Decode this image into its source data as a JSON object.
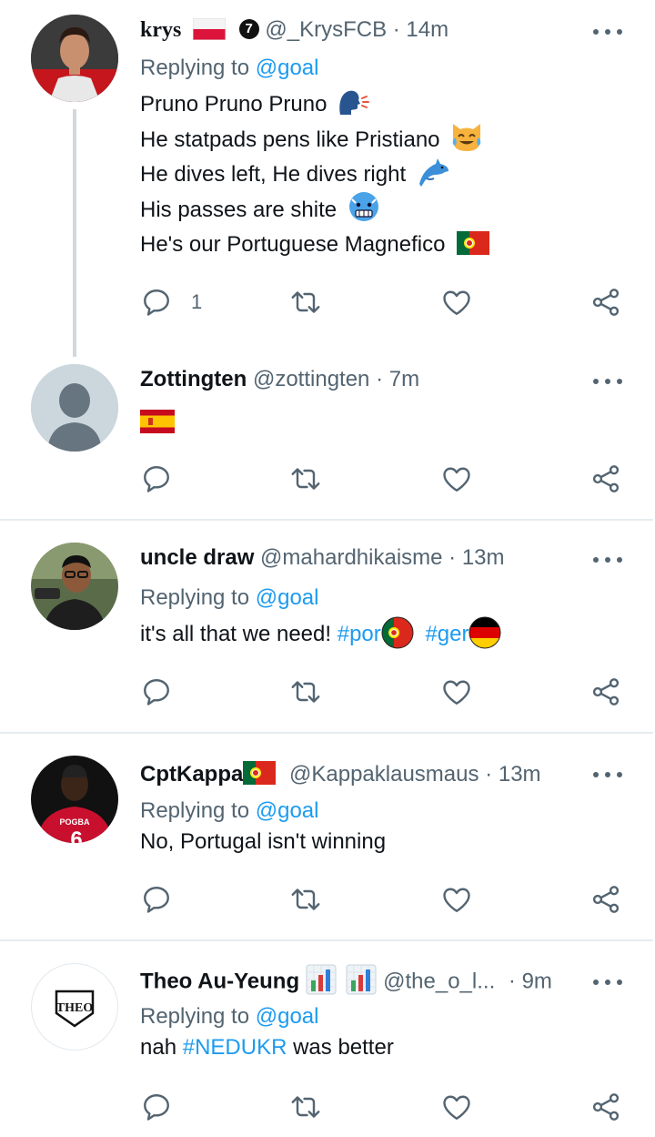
{
  "tweets": [
    {
      "name": "krys",
      "handle": "@_KrysFCB",
      "time": "14m",
      "badge": "7",
      "replying_prefix": "Replying to",
      "replying_to": "@goal",
      "lines": [
        "Pruno Pruno Pruno",
        "He statpads pens like Pristiano",
        "He dives left, He dives right",
        "His passes are shite",
        "He's our Portuguese Magnefico"
      ],
      "reply_count": "1"
    },
    {
      "name": "Zottingten",
      "handle": "@zottingten",
      "time": "7m"
    },
    {
      "name": "uncle draw",
      "handle": "@mahardhikaisme",
      "time": "13m",
      "replying_prefix": "Replying to",
      "replying_to": "@goal",
      "text": "it's all that we need!",
      "tag1": "#por",
      "tag2": "#ger"
    },
    {
      "name": "CptKappa",
      "handle": "@Kappaklausmaus",
      "time": "13m",
      "replying_prefix": "Replying to",
      "replying_to": "@goal",
      "text": "No, Portugal isn't winning",
      "avatar_text": "POGBA",
      "avatar_number": "6"
    },
    {
      "name": "Theo Au-Yeung",
      "handle": "@the_o_l...",
      "time": "9m",
      "replying_prefix": "Replying to",
      "replying_to": "@goal",
      "text_prefix": "nah",
      "hashtag": "#NEDUKR",
      "text_suffix": "was better",
      "avatar_logo": "THEO"
    }
  ],
  "separator": "·",
  "colors": {
    "link": "#1d9bf0",
    "secondary": "#536471",
    "divider": "#e6ecf0"
  },
  "icons": [
    "reply-icon",
    "retweet-icon",
    "like-icon",
    "share-icon",
    "more-icon"
  ]
}
